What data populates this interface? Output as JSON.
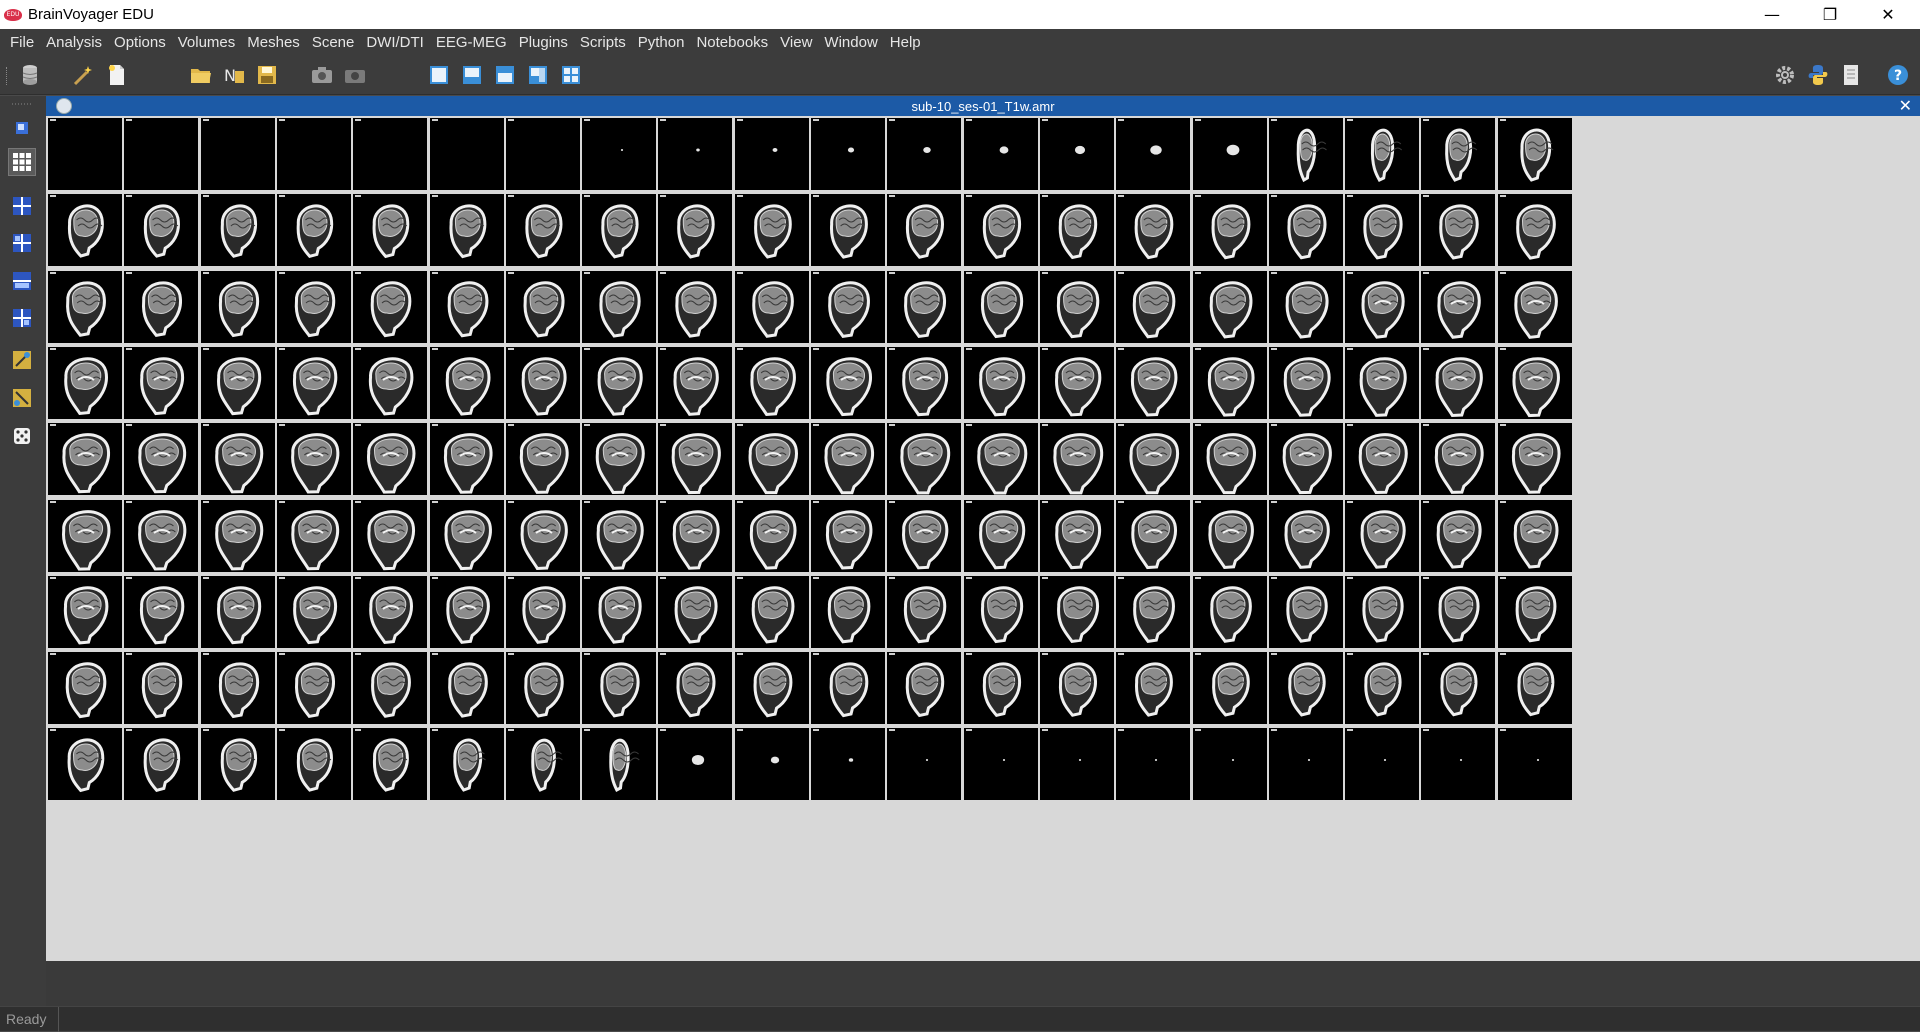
{
  "window": {
    "title": "BrainVoyager EDU",
    "logo_text": "EDU",
    "controls": {
      "minimize": "—",
      "restore": "❐",
      "close": "✕"
    }
  },
  "menubar": {
    "items": [
      "File",
      "Analysis",
      "Options",
      "Volumes",
      "Meshes",
      "Scene",
      "DWI/DTI",
      "EEG-MEG",
      "Plugins",
      "Scripts",
      "Python",
      "Notebooks",
      "View",
      "Window",
      "Help"
    ]
  },
  "toolbar": {
    "icons": [
      "database-icon",
      "wand-icon",
      "new-document-icon",
      "open-folder-icon",
      "open-recent-icon",
      "save-icon",
      "snapshot-icon",
      "camera-icon",
      "view-single-icon",
      "view-layout-1-icon",
      "view-layout-2-icon",
      "view-layout-3-icon",
      "view-layout-4-icon",
      "settings-gear-icon",
      "python-icon",
      "notebook-icon",
      "help-icon"
    ],
    "accent": "#3a8fd8"
  },
  "sidebar": {
    "icons": [
      "sidebar-grip-icon",
      "cursor-mode-icon",
      "mosaic-view-icon",
      "volume-view-1-icon",
      "volume-view-2-icon",
      "volume-view-3-icon",
      "volume-view-4-icon",
      "tools-1-icon",
      "tools-2-icon",
      "dice-icon"
    ],
    "selected_index": 2
  },
  "document": {
    "title": "sub-10_ses-01_T1w.amr",
    "close_label": "✕",
    "title_bar_color": "#1c5aa6"
  },
  "mosaic": {
    "rows": 9,
    "columns": 20,
    "view": "sagittal slices",
    "background": "#000000",
    "grid_color": "#d8d8d8"
  },
  "statusbar": {
    "text": "Ready"
  }
}
